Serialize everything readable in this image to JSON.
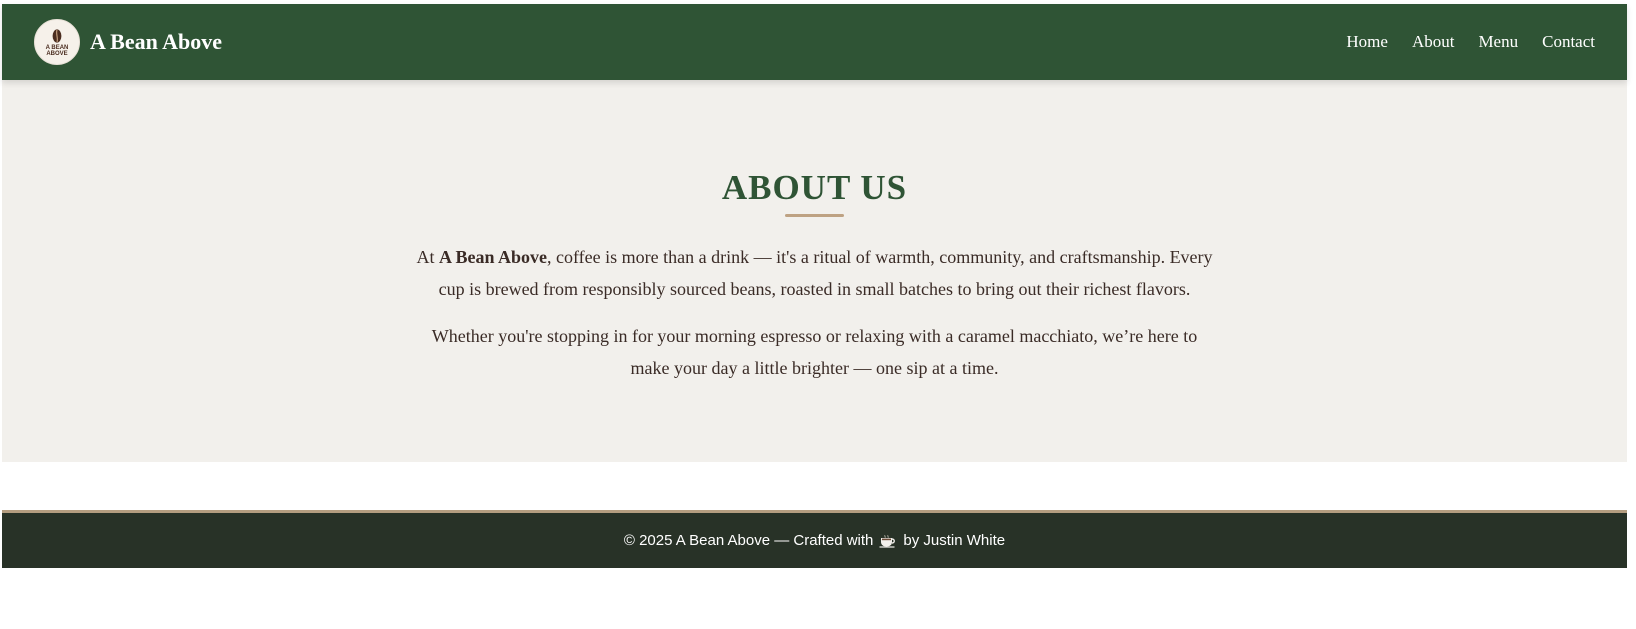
{
  "brand": {
    "name": "A Bean Above",
    "logo_text": "A BEAN ABOVE"
  },
  "nav": {
    "items": [
      {
        "label": "Home"
      },
      {
        "label": "About"
      },
      {
        "label": "Menu"
      },
      {
        "label": "Contact"
      }
    ]
  },
  "about": {
    "title": "ABOUT US",
    "p1_before": "At ",
    "p1_brand": "A Bean Above",
    "p1_after": ", coffee is more than a drink — it's a ritual of warmth, community, and craftsmanship. Every cup is brewed from responsibly sourced beans, roasted in small batches to bring out their richest flavors.",
    "p2": "Whether you're stopping in for your morning espresso or relaxing with a caramel macchiato, we’re here to make your day a little brighter — one sip at a time."
  },
  "footer": {
    "text_before": "© 2025 A Bean Above — Crafted with",
    "icon": "coffee-cup-icon",
    "text_after": "by Justin White"
  },
  "colors": {
    "header_bg": "#2f5435",
    "title_green": "#2f5435",
    "accent": "#bea283",
    "section_bg": "#f2f0ec",
    "footer_bg": "#283227",
    "text_brown": "#3a2b26"
  }
}
